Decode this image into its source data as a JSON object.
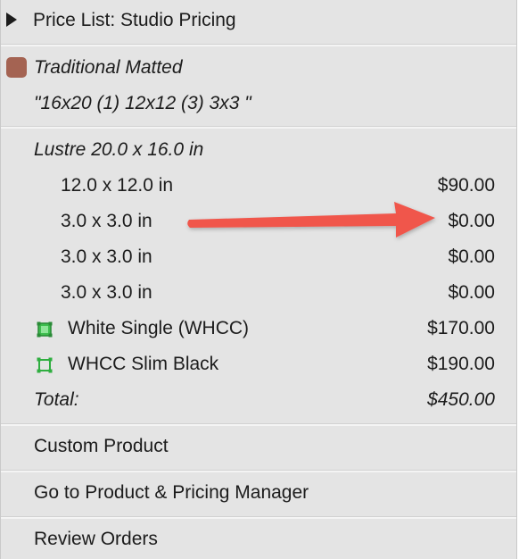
{
  "header": {
    "price_list_label": "Price List: Studio Pricing"
  },
  "product": {
    "color": "#a46352",
    "name": "Traditional Matted",
    "description": "\"16x20 (1) 12x12 (3) 3x3 \""
  },
  "order": {
    "main_item": "Lustre 20.0 x 16.0 in",
    "lines": [
      {
        "label": "12.0 x 12.0 in",
        "price": "$90.00"
      },
      {
        "label": "3.0 x 3.0 in",
        "price": "$0.00"
      },
      {
        "label": "3.0 x 3.0 in",
        "price": "$0.00"
      },
      {
        "label": "3.0 x 3.0 in",
        "price": "$0.00"
      }
    ],
    "frames": [
      {
        "label": "White Single (WHCC)",
        "price": "$170.00",
        "icon": "frame-filled-icon"
      },
      {
        "label": "WHCC Slim Black",
        "price": "$190.00",
        "icon": "frame-outline-icon"
      }
    ],
    "total_label": "Total:",
    "total_value": "$450.00"
  },
  "menu": {
    "items": [
      {
        "label": "Custom Product"
      },
      {
        "label": "Go to Product & Pricing Manager"
      },
      {
        "label": "Review Orders"
      }
    ]
  },
  "annotation": {
    "arrow_color": "#f0564b",
    "icon": "red-arrow-annotation"
  }
}
